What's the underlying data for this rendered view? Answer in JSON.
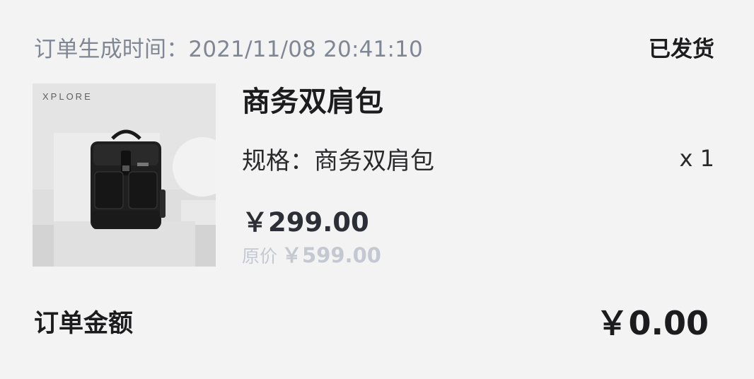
{
  "order": {
    "time_label": "订单生成时间：",
    "time_value": "2021/11/08 20:41:10",
    "status": "已发货"
  },
  "product": {
    "brand_logo_text": "XPLORE",
    "image_icon": "backpack-product-photo",
    "name": "商务双肩包",
    "spec_label": "规格：",
    "spec_value": "商务双肩包",
    "quantity": "x 1",
    "price": "￥299.00",
    "original_price_label": "原价",
    "original_price": "￥599.00"
  },
  "total": {
    "label": "订单金额",
    "amount": "￥0.00"
  },
  "colors": {
    "background": "#f3f3f3",
    "primary_text": "#1c1c1e",
    "secondary_text": "#7f8794",
    "muted_price": "#c4c8d0"
  }
}
